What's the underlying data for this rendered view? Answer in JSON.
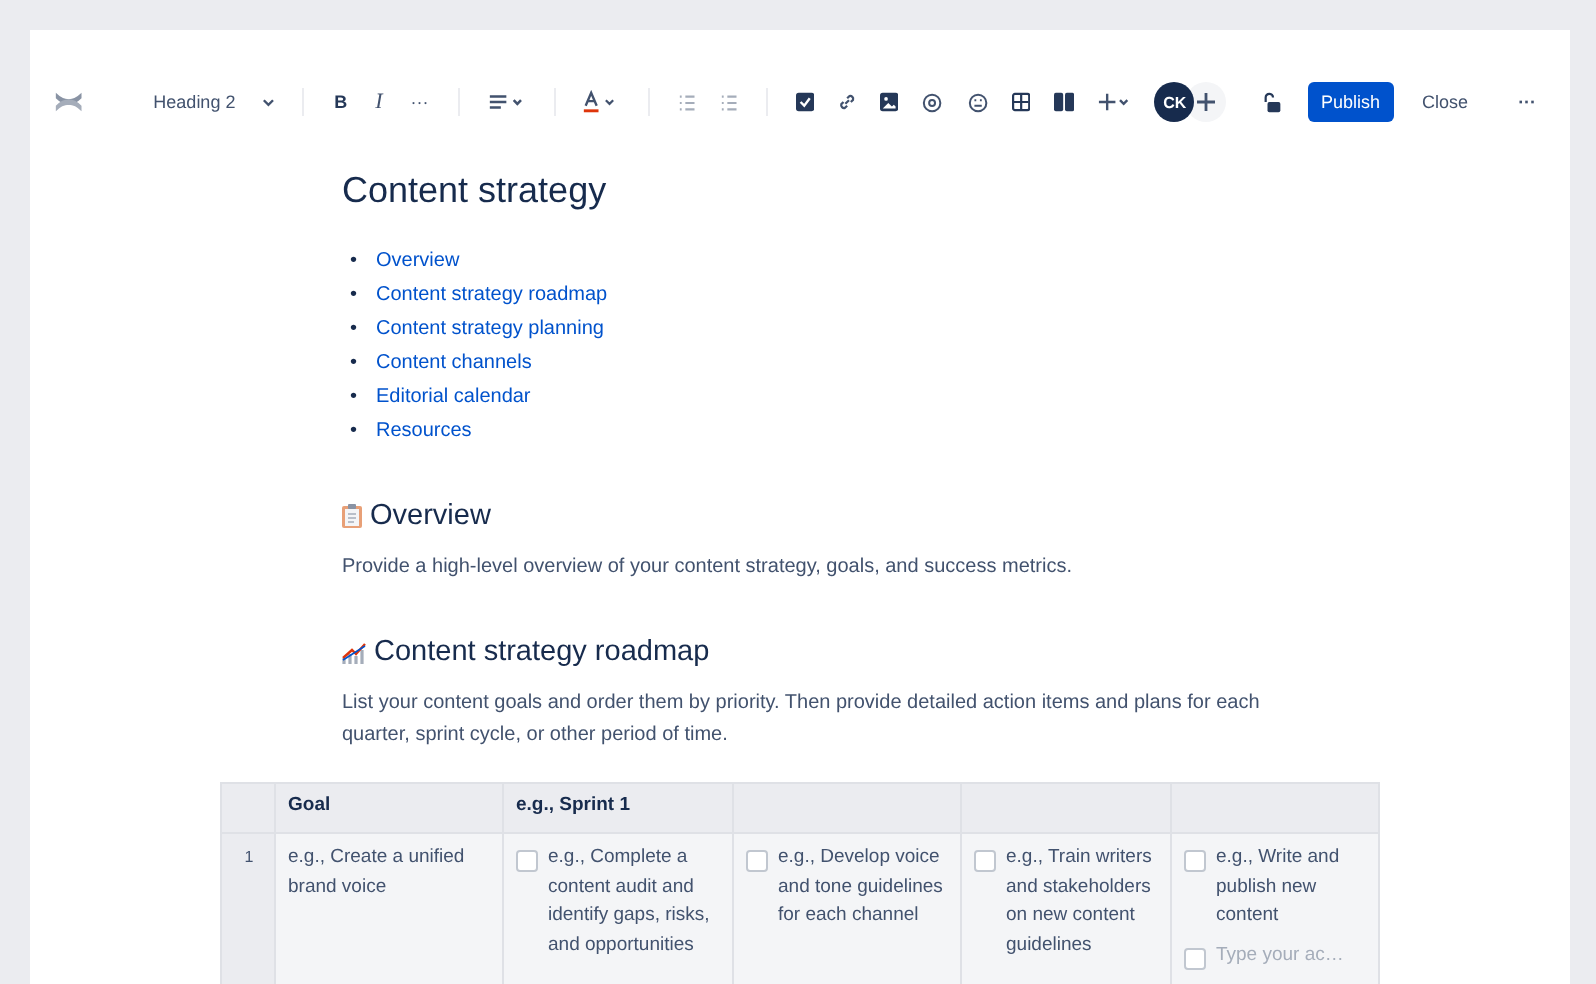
{
  "toolbar": {
    "style_menu": "Heading 2",
    "bold": "B",
    "italic": "I",
    "more": "···",
    "avatar": "CK",
    "publish": "Publish",
    "close": "Close",
    "menu": "···"
  },
  "page": {
    "title": "Content strategy",
    "toc": [
      {
        "marker": "•",
        "text": "Overview"
      },
      {
        "marker": "•",
        "text": "Content strategy roadmap"
      },
      {
        "marker": "•",
        "text": "Content strategy planning"
      },
      {
        "marker": "•",
        "text": "Content channels"
      },
      {
        "marker": "•",
        "text": "Editorial calendar"
      },
      {
        "marker": "•",
        "text": "Resources"
      }
    ],
    "sections": [
      {
        "kind": "clipboard",
        "heading": "Overview",
        "text": "Provide a high-level overview of your content strategy, goals, and success metrics."
      },
      {
        "kind": "chart",
        "heading": "Content strategy roadmap",
        "text": "List your content goals and order them by priority. Then provide detailed action items and plans for each quarter, sprint cycle, or other period of time."
      }
    ]
  },
  "table": {
    "columns": [
      "",
      "Goal",
      "e.g., Sprint 1",
      "",
      "",
      ""
    ],
    "rows": [
      {
        "cells": [
          {
            "kind": "number",
            "text": "1"
          },
          {
            "kind": "text",
            "text": "e.g., Create a unified brand voice"
          },
          {
            "kind": "tasks",
            "items": [
              {
                "kind": "task",
                "text": "e.g., Complete a content audit and identify gaps, risks, and opportunities",
                "checked": false
              }
            ]
          },
          {
            "kind": "tasks",
            "items": [
              {
                "kind": "task",
                "text": "e.g., Develop voice and tone guidelines for each channel",
                "checked": false
              }
            ]
          },
          {
            "kind": "tasks",
            "items": [
              {
                "kind": "task",
                "text": "e.g., Train writers and stakeholders on new content guidelines",
                "checked": false
              }
            ]
          },
          {
            "kind": "tasks",
            "items": [
              {
                "kind": "task",
                "text": "e.g., Write and publish new content",
                "checked": false
              },
              {
                "kind": "placeholder",
                "text": "Type your ac…",
                "checked": false
              }
            ]
          }
        ]
      }
    ]
  }
}
